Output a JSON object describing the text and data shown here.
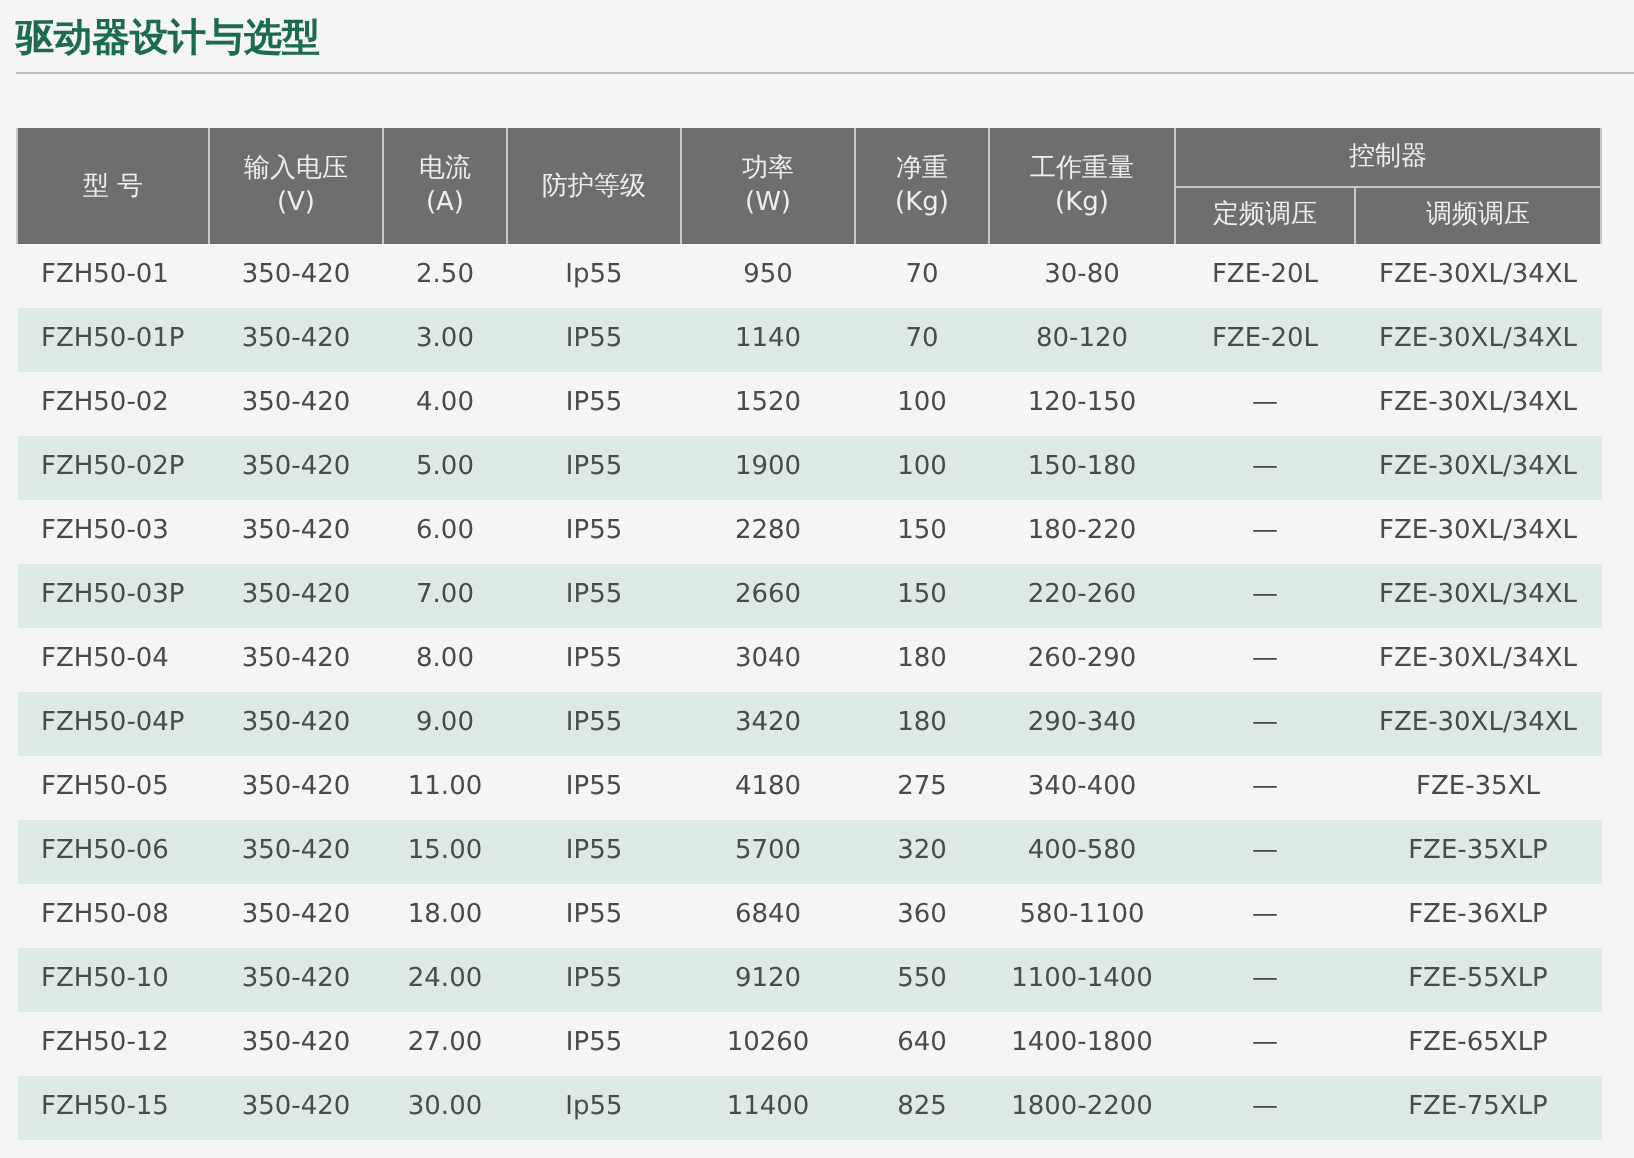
{
  "title": "驱动器设计与选型",
  "table": {
    "columns": [
      {
        "label": "型 号"
      },
      {
        "label": "输入电压",
        "unit": "(V)"
      },
      {
        "label": "电流",
        "unit": "(A)"
      },
      {
        "label": "防护等级"
      },
      {
        "label": "功率",
        "unit": "(W)"
      },
      {
        "label": "净重",
        "unit": "(Kg)"
      },
      {
        "label": "工作重量",
        "unit": "(Kg)"
      }
    ],
    "group": {
      "label": "控制器",
      "subcolumns": [
        "定频调压",
        "调频调压"
      ]
    },
    "rows": [
      [
        "FZH50-01",
        "350-420",
        "2.50",
        "Ip55",
        "950",
        "70",
        "30-80",
        "FZE-20L",
        "FZE-30XL/34XL"
      ],
      [
        "FZH50-01P",
        "350-420",
        "3.00",
        "IP55",
        "1140",
        "70",
        "80-120",
        "FZE-20L",
        "FZE-30XL/34XL"
      ],
      [
        "FZH50-02",
        "350-420",
        "4.00",
        "IP55",
        "1520",
        "100",
        "120-150",
        "—",
        "FZE-30XL/34XL"
      ],
      [
        "FZH50-02P",
        "350-420",
        "5.00",
        "IP55",
        "1900",
        "100",
        "150-180",
        "—",
        "FZE-30XL/34XL"
      ],
      [
        "FZH50-03",
        "350-420",
        "6.00",
        "IP55",
        "2280",
        "150",
        "180-220",
        "—",
        "FZE-30XL/34XL"
      ],
      [
        "FZH50-03P",
        "350-420",
        "7.00",
        "IP55",
        "2660",
        "150",
        "220-260",
        "—",
        "FZE-30XL/34XL"
      ],
      [
        "FZH50-04",
        "350-420",
        "8.00",
        "IP55",
        "3040",
        "180",
        "260-290",
        "—",
        "FZE-30XL/34XL"
      ],
      [
        "FZH50-04P",
        "350-420",
        "9.00",
        "IP55",
        "3420",
        "180",
        "290-340",
        "—",
        "FZE-30XL/34XL"
      ],
      [
        "FZH50-05",
        "350-420",
        "11.00",
        "IP55",
        "4180",
        "275",
        "340-400",
        "—",
        "FZE-35XL"
      ],
      [
        "FZH50-06",
        "350-420",
        "15.00",
        "IP55",
        "5700",
        "320",
        "400-580",
        "—",
        "FZE-35XLP"
      ],
      [
        "FZH50-08",
        "350-420",
        "18.00",
        "IP55",
        "6840",
        "360",
        "580-1100",
        "—",
        "FZE-36XLP"
      ],
      [
        "FZH50-10",
        "350-420",
        "24.00",
        "IP55",
        "9120",
        "550",
        "1100-1400",
        "—",
        "FZE-55XLP"
      ],
      [
        "FZH50-12",
        "350-420",
        "27.00",
        "IP55",
        "10260",
        "640",
        "1400-1800",
        "—",
        "FZE-65XLP"
      ],
      [
        "FZH50-15",
        "350-420",
        "30.00",
        "Ip55",
        "11400",
        "825",
        "1800-2200",
        "—",
        "FZE-75XLP"
      ]
    ]
  }
}
